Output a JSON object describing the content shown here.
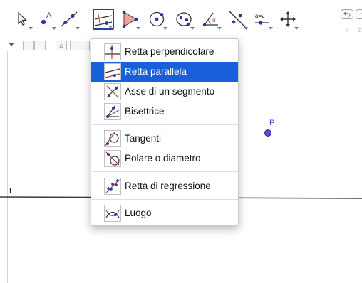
{
  "toolbar": {
    "tools": [
      {
        "name": "move-tool",
        "icon": "arrow-pointer-icon"
      },
      {
        "name": "point-tool",
        "icon": "point-a-icon",
        "label": "A"
      },
      {
        "name": "line-tool",
        "icon": "line-through-two-points-icon"
      },
      {
        "name": "special-line-tool",
        "icon": "parallel-lines-icon",
        "active": true
      },
      {
        "name": "polygon-tool",
        "icon": "triangle-icon"
      },
      {
        "name": "circle-tool",
        "icon": "circle-center-point-icon"
      },
      {
        "name": "conic-tool",
        "icon": "ellipse-icon"
      },
      {
        "name": "angle-tool",
        "icon": "angle-icon",
        "label": "α"
      },
      {
        "name": "transform-tool",
        "icon": "reflect-line-icon"
      },
      {
        "name": "slider-tool",
        "icon": "slider-icon",
        "label": "a=2"
      },
      {
        "name": "move-view-tool",
        "icon": "move-graphics-view-icon"
      }
    ],
    "window_controls": [
      "undo-icon",
      "redo-icon"
    ],
    "small_icons": [
      "help-icon",
      "settings-icon"
    ]
  },
  "graphics": {
    "line_label": "r",
    "point_label": "P",
    "colors": {
      "point_fill": "#5b4fd8",
      "point_label": "#4b46c9",
      "line": "#3a3a3a"
    }
  },
  "menu": {
    "items": [
      {
        "label": "Retta perpendicolare",
        "icon": "perpendicular-line-icon"
      },
      {
        "label": "Retta parallela",
        "icon": "parallel-line-icon",
        "selected": true
      },
      {
        "label": "Asse di un segmento",
        "icon": "perpendicular-bisector-icon"
      },
      {
        "label": "Bisettrice",
        "icon": "angle-bisector-icon"
      },
      {
        "label": "Tangenti",
        "icon": "tangents-icon"
      },
      {
        "label": "Polare o diametro",
        "icon": "polar-diameter-icon"
      },
      {
        "label": "Retta di regressione",
        "icon": "best-fit-line-icon"
      },
      {
        "label": "Luogo",
        "icon": "locus-icon"
      }
    ],
    "selection_color": "#1760d9"
  }
}
